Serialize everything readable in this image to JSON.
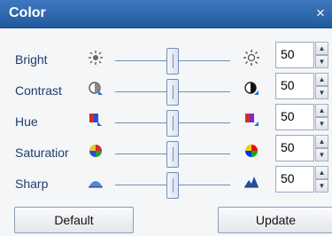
{
  "window": {
    "title": "Color",
    "close_symbol": "×"
  },
  "rows": [
    {
      "label": "Bright",
      "value": "50",
      "left_icon": "brightness-low-icon",
      "right_icon": "brightness-high-icon"
    },
    {
      "label": "Contrast",
      "value": "50",
      "left_icon": "contrast-low-icon",
      "right_icon": "contrast-high-icon"
    },
    {
      "label": "Hue",
      "value": "50",
      "left_icon": "hue-low-icon",
      "right_icon": "hue-high-icon"
    },
    {
      "label": "Saturatior",
      "value": "50",
      "left_icon": "saturation-low-icon",
      "right_icon": "saturation-high-icon"
    },
    {
      "label": "Sharp",
      "value": "50",
      "left_icon": "sharpness-low-icon",
      "right_icon": "sharpness-high-icon"
    }
  ],
  "slider_level": 0.5,
  "spin": {
    "up_symbol": "▲",
    "down_symbol": "▼"
  },
  "buttons": {
    "default_label": "Default",
    "update_label": "Update"
  }
}
